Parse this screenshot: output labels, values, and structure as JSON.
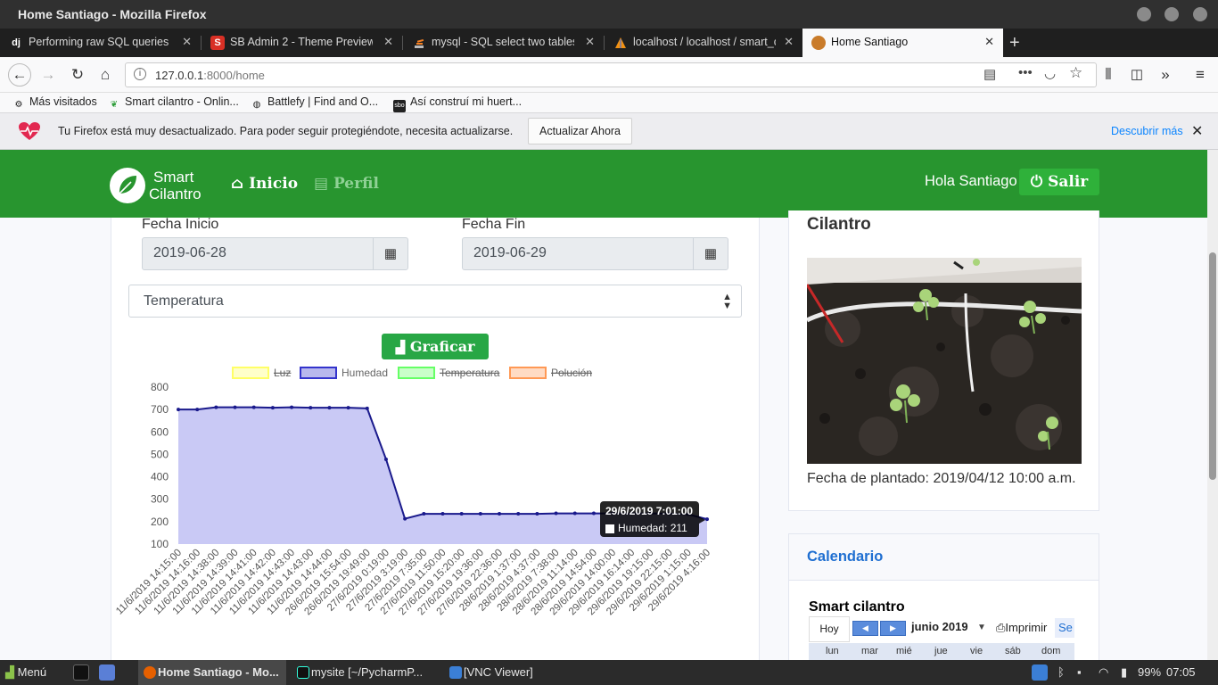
{
  "window": {
    "title": "Home Santiago - Mozilla Firefox"
  },
  "tabs": [
    {
      "label": "Performing raw SQL queries",
      "icon": "dj"
    },
    {
      "label": "SB Admin 2 - Theme Preview",
      "icon": "S"
    },
    {
      "label": "mysql - SQL select two tables",
      "icon": ""
    },
    {
      "label": "localhost / localhost / smart_c",
      "icon": ""
    },
    {
      "label": "Home Santiago",
      "icon": ""
    }
  ],
  "navbar": {
    "url_host": "127.0.0.1",
    "url_path": ":8000/home"
  },
  "bookmarks": [
    {
      "label": "Más visitados"
    },
    {
      "label": "Smart cilantro - Onlin..."
    },
    {
      "label": "Battlefy | Find and O..."
    },
    {
      "label": "Así construí mi huert..."
    }
  ],
  "notification": {
    "message": "Tu Firefox está muy desactualizado. Para poder seguir protegiéndote, necesita actualizarse.",
    "button": "Actualizar Ahora",
    "link": "Descubrir más",
    "close": "✕"
  },
  "app": {
    "logo_line1": "Smart",
    "logo_line2": "Cilantro",
    "nav_inicio": "Inicio",
    "nav_perfil": "Perfil",
    "greeting": "Hola Santiago",
    "logout": "Salir"
  },
  "filters": {
    "start_label": "Fecha Inicio",
    "start_value": "2019-06-28",
    "end_label": "Fecha Fin",
    "end_value": "2019-06-29",
    "sensor_selected": "Temperatura",
    "submit": "Graficar"
  },
  "chart_data": {
    "type": "area",
    "legend": [
      {
        "name": "Luz",
        "color": "#ffff66",
        "hidden": true
      },
      {
        "name": "Humedad",
        "color": "#3333cc",
        "hidden": false
      },
      {
        "name": "Temperatura",
        "color": "#66ff66",
        "hidden": true
      },
      {
        "name": "Polución",
        "color": "#ff9955",
        "hidden": true
      }
    ],
    "ylim": [
      100,
      800
    ],
    "yticks": [
      800,
      700,
      600,
      500,
      400,
      300,
      200,
      100
    ],
    "categories": [
      "11/6/2019 14:15:00",
      "11/6/2019 14:16:00",
      "11/6/2019 14:38:00",
      "11/6/2019 14:39:00",
      "11/6/2019 14:41:00",
      "11/6/2019 14:42:00",
      "11/6/2019 14:43:00",
      "11/6/2019 14:43:00",
      "11/6/2019 14:44:00",
      "26/6/2019 15:54:00",
      "26/6/2019 19:49:00",
      "27/6/2019 0:19:00",
      "27/6/2019 3:19:00",
      "27/6/2019 7:35:00",
      "27/6/2019 11:50:00",
      "27/6/2019 15:20:00",
      "27/6/2019 19:36:00",
      "27/6/2019 22:36:00",
      "28/6/2019 1:37:00",
      "28/6/2019 4:37:00",
      "28/6/2019 7:38:00",
      "28/6/2019 11:14:00",
      "28/6/2019 14:54:00",
      "29/6/2019 14:00:00",
      "29/6/2019 16:14:00",
      "29/6/2019 19:15:00",
      "29/6/2019 22:15:00",
      "29/6/2019 1:15:00",
      "29/6/2019 4:16:00"
    ],
    "series": [
      {
        "name": "Humedad",
        "color": "#1a1a8c",
        "fill": "#c9c9f5",
        "values": [
          700,
          700,
          710,
          710,
          710,
          708,
          710,
          708,
          708,
          708,
          705,
          478,
          213,
          235,
          235,
          235,
          235,
          235,
          235,
          235,
          237,
          237,
          237,
          237,
          237,
          237,
          236,
          233,
          211
        ]
      }
    ],
    "tooltip": {
      "title": "29/6/2019 7:01:00",
      "label": "Humedad: 211"
    }
  },
  "plant": {
    "title": "Cilantro",
    "planted": "Fecha de plantado: 2019/04/12 10:00 a.m."
  },
  "calendar": {
    "header": "Calendario",
    "title": "Smart cilantro",
    "today": "Hoy",
    "month": "junio 2019",
    "print": "Imprimir",
    "more": "Se",
    "days": [
      "lun",
      "mar",
      "mié",
      "jue",
      "vie",
      "sáb",
      "dom"
    ]
  },
  "taskbar": {
    "menu": "Menú",
    "tasks": [
      "Home Santiago - Mo...",
      "mysite [~/PycharmP...",
      "[VNC Viewer]"
    ],
    "battery": "99%",
    "clock": "07:05"
  }
}
